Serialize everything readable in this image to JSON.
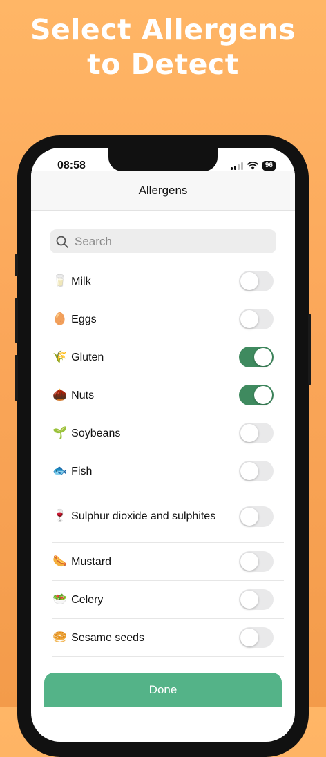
{
  "headline": {
    "line1": "Select Allergens",
    "line2": "to Detect"
  },
  "status_bar": {
    "time": "08:58",
    "battery": "96"
  },
  "navbar": {
    "title": "Allergens"
  },
  "search": {
    "placeholder": "Search",
    "icon": "magnifying-glass"
  },
  "allergens": [
    {
      "emoji": "🥛",
      "label": "Milk",
      "enabled": false
    },
    {
      "emoji": "🥚",
      "label": "Eggs",
      "enabled": false
    },
    {
      "emoji": "🌾",
      "label": "Gluten",
      "enabled": true
    },
    {
      "emoji": "🌰",
      "label": "Nuts",
      "enabled": true
    },
    {
      "emoji": "🌱",
      "label": "Soybeans",
      "enabled": false
    },
    {
      "emoji": "🐟",
      "label": "Fish",
      "enabled": false
    },
    {
      "emoji": "🍷",
      "label": "Sulphur dioxide and sulphites",
      "enabled": false
    },
    {
      "emoji": "🌭",
      "label": "Mustard",
      "enabled": false
    },
    {
      "emoji": "🥗",
      "label": "Celery",
      "enabled": false
    },
    {
      "emoji": "🥯",
      "label": "Sesame seeds",
      "enabled": false
    }
  ],
  "done_button": {
    "label": "Done"
  },
  "colors": {
    "background": "#fba75a",
    "toggle_on": "#3f8a5f",
    "done_button": "#54b388"
  }
}
